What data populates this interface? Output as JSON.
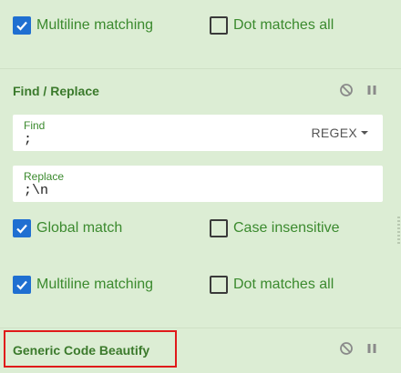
{
  "top_options": {
    "multiline": {
      "label": "Multiline matching",
      "checked": true
    },
    "dot_all": {
      "label": "Dot matches all",
      "checked": false
    }
  },
  "find_replace": {
    "title": "Find / Replace",
    "find": {
      "label": "Find",
      "value": ";",
      "mode": "REGEX"
    },
    "replace": {
      "label": "Replace",
      "value": ";\\n"
    },
    "global_match": {
      "label": "Global match",
      "checked": true
    },
    "case_insensitive": {
      "label": "Case insensitive",
      "checked": false
    },
    "multiline": {
      "label": "Multiline matching",
      "checked": true
    },
    "dot_all": {
      "label": "Dot matches all",
      "checked": false
    },
    "icons": [
      "disable-icon",
      "pause-icon"
    ]
  },
  "generic_code_beautify": {
    "title": "Generic Code Beautify",
    "icons": [
      "disable-icon",
      "pause-icon"
    ]
  },
  "colors": {
    "background": "#dcedd4",
    "label_green": "#3b8a2e",
    "checkbox_blue": "#1f6fd1",
    "highlight_red": "#e01a1a"
  }
}
